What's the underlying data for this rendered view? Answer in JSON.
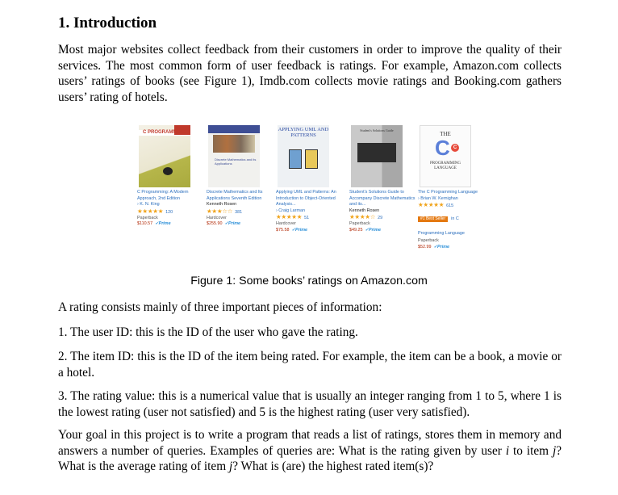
{
  "section": {
    "heading": "1.  Introduction"
  },
  "paragraphs": {
    "intro": "Most major websites collect feedback from their customers in order to improve the quality of their services. The most common form of user feedback is ratings. For example, Amazon.com collects users’ ratings of books (see Figure 1), Imdb.com collects movie ratings and Booking.com gathers users’ rating of hotels.",
    "rating_info": "A rating consists mainly of three important pieces of information:",
    "item1": "1. The user ID: this is the ID of the user who gave the rating.",
    "item2": "2. The item ID: this is the ID of the item being rated. For example, the item can be a book, a movie or a hotel.",
    "item3": "3. The rating value: this is a numerical value that is usually an integer ranging from 1 to 5, where 1 is the lowest rating (user not satisfied) and 5 is the highest rating (user very satisfied).",
    "goal_a": "Your goal in this project is to write a program that reads a list of ratings, stores them in memory and answers a number of queries. Examples of queries are: What is the rating given by user ",
    "goal_i": "i",
    "goal_b": " to item ",
    "goal_j1": "j",
    "goal_c": "? What is the average rating of item ",
    "goal_j2": "j",
    "goal_d": "? What is (are) the highest rated item(s)?"
  },
  "figure": {
    "caption": "Figure 1: Some books’ ratings on Amazon.com",
    "books": [
      {
        "cover_text": "C PROGRAMMING",
        "title": "C Programming: A Modern Approach, 2nd Edition",
        "author": "› K. N. King",
        "rating": 4.5,
        "stars": "★★★★★",
        "review_count": "120",
        "format": "Paperback",
        "price": "$110.57",
        "prime": "✓Prime"
      },
      {
        "cover_text": "Discrete Mathematics and its Applications",
        "title": "Discrete Mathematics and Its Applications Seventh Edition",
        "author": "Kenneth Rosen",
        "rating": 2.5,
        "stars": "★★★☆☆",
        "review_count": "381",
        "format": "Hardcover",
        "price": "$255.90",
        "prime": "✓Prime"
      },
      {
        "cover_text": "APPLYING UML AND PATTERNS",
        "title": "Applying UML and Patterns: An Introduction to Object-Oriented Analysis...",
        "author": "› Craig Larman",
        "rating": 4.5,
        "stars": "★★★★★",
        "review_count": "51",
        "format": "Hardcover",
        "price": "$75.58",
        "prime": "✓Prime"
      },
      {
        "cover_text": "Student's Solutions Guide",
        "title": "Student's Solutions Guide to Accompany Discrete Mathematics and its...",
        "author": "Kenneth Rosen",
        "rating": 4,
        "stars": "★★★★☆",
        "review_count": "29",
        "format": "Paperback",
        "price": "$49.25",
        "prime": "✓Prime"
      },
      {
        "cover_text_the": "THE",
        "cover_text_c": "C",
        "cover_text_pl": "PROGRAMMING LANGUAGE",
        "title": "The C Programming Language",
        "author": "› Brian W. Kernighan",
        "rating": 4.5,
        "stars": "★★★★★",
        "review_count": "615",
        "badge": "#1 Best Seller",
        "badge_category": "in C Programming Language",
        "format": "Paperback",
        "price": "$52.99",
        "prime": "✓Prime"
      }
    ]
  }
}
